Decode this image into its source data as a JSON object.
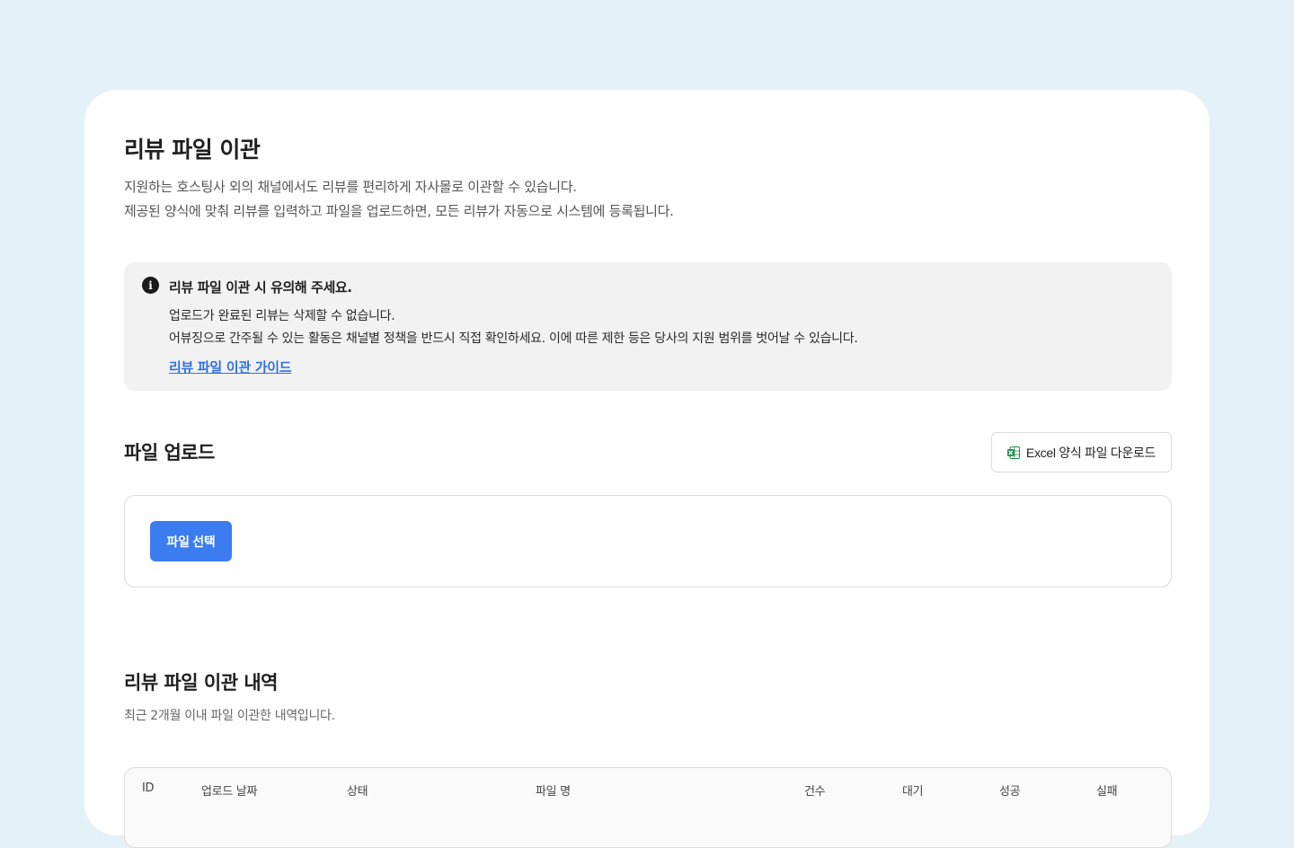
{
  "page": {
    "title": "리뷰 파일 이관",
    "description": [
      "지원하는 호스팅사 외의 채널에서도 리뷰를 편리하게 자사몰로 이관할 수 있습니다.",
      "제공된 양식에 맞춰 리뷰를 입력하고 파일을 업로드하면, 모든 리뷰가 자동으로 시스템에 등록됩니다."
    ]
  },
  "notice": {
    "icon": "info-icon",
    "title": "리뷰 파일 이관 시 유의해 주세요.",
    "lines": [
      "업로드가 완료된 리뷰는 삭제할 수 없습니다.",
      "어뷰징으로 간주될 수 있는 활동은 채널별 정책을 반드시 직접 확인하세요. 이에 따른 제한 등은 당사의 지원 범위를 벗어날 수 있습니다."
    ],
    "link_label": "리뷰 파일 이관 가이드"
  },
  "upload": {
    "title": "파일 업로드",
    "excel_button_label": "Excel 양식 파일 다운로드",
    "excel_icon": "excel-icon",
    "file_select_label": "파일 선택"
  },
  "history": {
    "title": "리뷰 파일 이관 내역",
    "subtitle": "최근 2개월 이내 파일 이관한 내역입니다.",
    "columns": [
      "ID",
      "업로드 날짜",
      "상태",
      "파일 명",
      "건수",
      "대기",
      "성공",
      "실패"
    ]
  },
  "colors": {
    "background": "#e4f1f9",
    "accent": "#3b7cf0",
    "link": "#2f6fe4",
    "excel_green": "#1f8f4e"
  }
}
